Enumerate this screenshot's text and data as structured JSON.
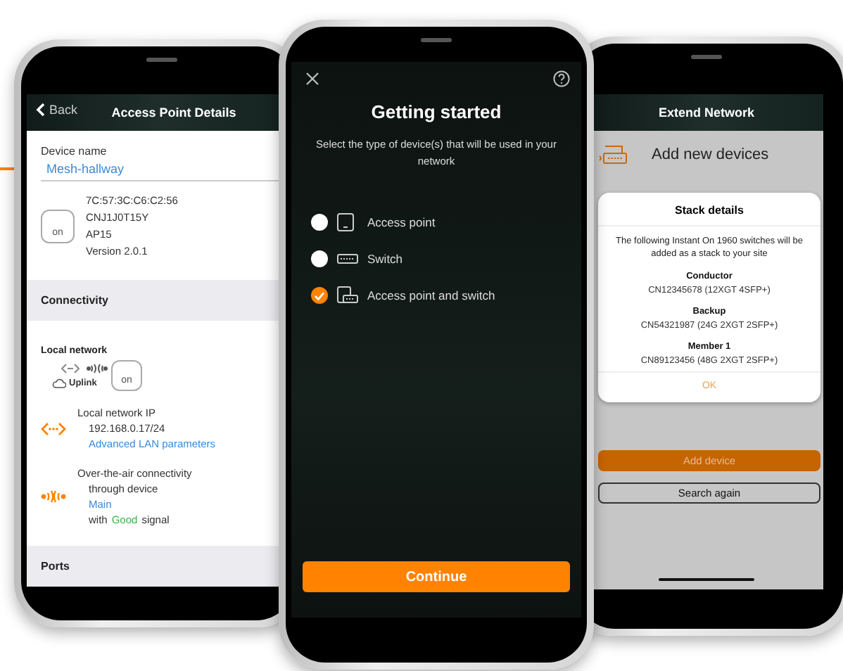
{
  "left_screen": {
    "back": "Back",
    "title": "Access Point Details",
    "device_name_label": "Device name",
    "device_name": "Mesh-hallway",
    "device_logo": "on",
    "device_info": [
      "7C:57:3C:C6:C2:56",
      "CNJ1J0T15Y",
      "AP15",
      "Version 2.0.1"
    ],
    "section_connectivity": "Connectivity",
    "local_network": {
      "title": "Local network",
      "uplink": "Uplink",
      "device_logo": "on"
    },
    "ip": {
      "label": "Local network IP",
      "value": "192.168.0.17/24",
      "link": "Advanced LAN parameters"
    },
    "ota": {
      "label": "Over-the-air connectivity",
      "through": "through device",
      "link": "Main",
      "signal_prefix": "with",
      "signal_quality": "Good",
      "signal_suffix": "signal"
    },
    "section_ports": "Ports"
  },
  "center_screen": {
    "title": "Getting started",
    "subtitle": "Select the type of device(s) that will be used in your network",
    "options": [
      {
        "kind": "access-point",
        "label": "Access point",
        "selected": false
      },
      {
        "kind": "switch",
        "label": "Switch",
        "selected": false
      },
      {
        "kind": "both",
        "label": "Access point and switch",
        "selected": true
      }
    ],
    "button": "Continue"
  },
  "right_screen": {
    "title": "Extend Network",
    "heading": "Add new devices",
    "dialog": {
      "title": "Stack details",
      "message": "The following Instant On 1960 switches will be added as a stack to your site",
      "members": [
        {
          "role": "Conductor",
          "value": "CN12345678 (12XGT 4SFP+)"
        },
        {
          "role": "Backup",
          "value": "CN54321987 (24G 2XGT 2SFP+)"
        },
        {
          "role": "Member 1",
          "value": "CN89123456 (48G 2XGT 2SFP+)"
        }
      ],
      "ok": "OK"
    },
    "add_button": "Add device",
    "search_button": "Search again"
  }
}
